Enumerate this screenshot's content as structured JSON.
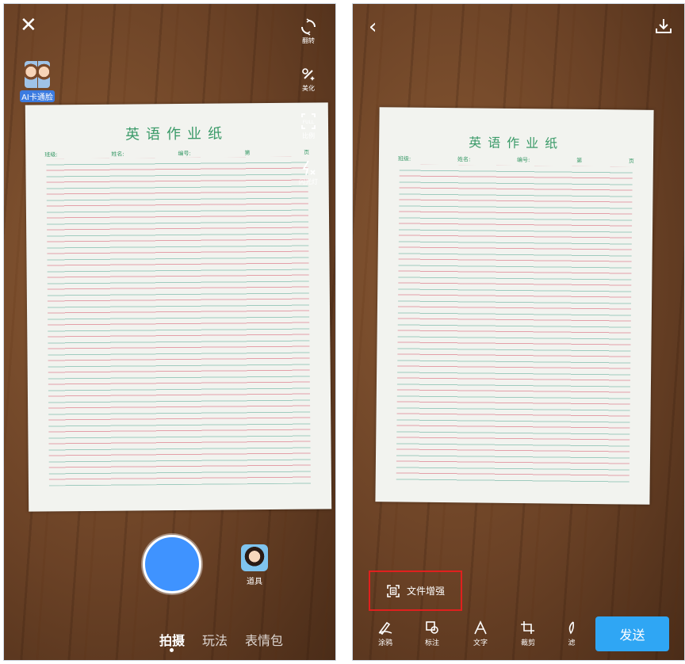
{
  "camera": {
    "close_icon": "close-icon",
    "side_tools": [
      {
        "label": "翻转",
        "icon": "flip-camera-icon"
      },
      {
        "label": "美化",
        "icon": "beautify-icon"
      },
      {
        "label": "比例",
        "icon": "aspect-ratio-icon",
        "icon_text": "FULL"
      },
      {
        "label": "闪光灯",
        "icon": "flash-off-icon"
      }
    ],
    "face_effect_label": "AI卡通脸",
    "props_label": "道具",
    "mode_tabs": [
      "拍摄",
      "玩法",
      "表情包"
    ],
    "active_mode": "拍摄",
    "shutter_color": "#3f93ff"
  },
  "paper": {
    "title": "英语作业纸",
    "fields": [
      "班级:",
      "姓名:",
      "编号:",
      "第",
      "页"
    ]
  },
  "editor": {
    "back_icon": "back-icon",
    "download_icon": "download-icon",
    "enhance_label": "文件增强",
    "enhance_highlight_color": "#e0201e",
    "tools": [
      {
        "label": "涂鸦",
        "icon": "doodle-icon"
      },
      {
        "label": "标注",
        "icon": "annotate-icon"
      },
      {
        "label": "文字",
        "icon": "text-icon"
      },
      {
        "label": "裁剪",
        "icon": "crop-icon"
      },
      {
        "label": "滤",
        "icon": "filter-icon"
      }
    ],
    "send_label": "发送",
    "send_color": "#2fa6f4"
  }
}
